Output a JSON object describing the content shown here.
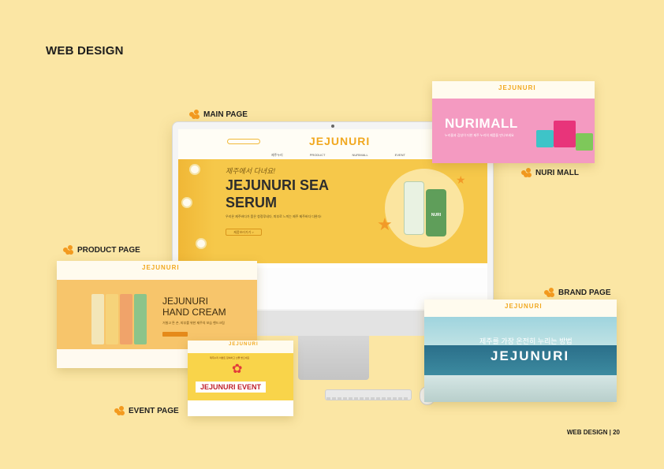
{
  "page": {
    "heading": "WEB DESIGN",
    "footer": "WEB DESIGN | 20"
  },
  "labels": {
    "main": "MAIN PAGE",
    "nuri": "NURI MALL",
    "product": "PRODUCT PAGE",
    "brand": "BRAND PAGE",
    "event": "EVENT PAGE"
  },
  "brand": {
    "logo": "JEJUNURI"
  },
  "main_page": {
    "nav": [
      "제주누리",
      "PRODUCT",
      "NURIMALL",
      "EVENT"
    ],
    "script": "제주에서 다녀요!",
    "title": "JEJUNURI SEA SERUM",
    "subtitle": "우리온 제주바다가 품은 청정루네다, 피부로 느끼는 제주 제주바다 다완다!",
    "button": "제품보러가기 >",
    "bottle_label": "NURI"
  },
  "nuri_mall": {
    "title": "NURIMALL",
    "desc": "누리몰과 감성이 더한 제주 누리의 제품을 만나보세요"
  },
  "product_page": {
    "title_line1": "JEJUNURI",
    "title_line2": "HAND CREAM",
    "desc": "거칠고 튼 손, 피부를 위한 제주의 보습 핸드크림"
  },
  "event_page": {
    "desc": "제주누리 이벤트 참여하고 선물 받으세요",
    "title": "JEJUNURI EVENT"
  },
  "brand_page": {
    "tagline": "제주를 가장 온전히 누리는 방법"
  },
  "colors": {
    "background": "#fbe6a4",
    "accent": "#f39a1f",
    "brand_green": "#3c9a4b"
  }
}
